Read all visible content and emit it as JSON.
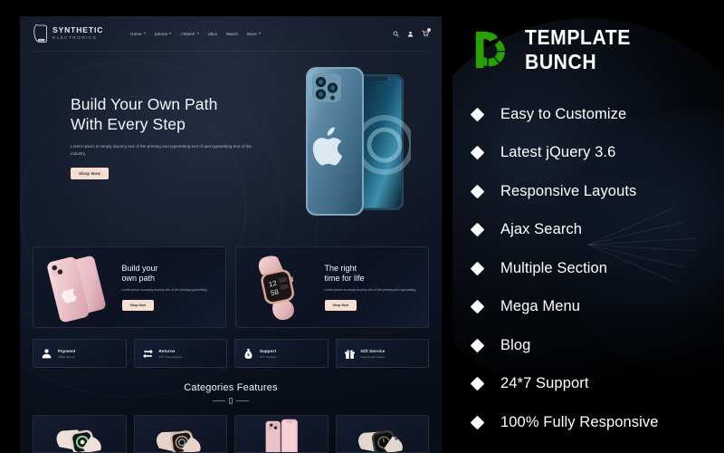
{
  "promo_panel": {
    "brand_name": "TEMPLATE BUNCH",
    "logo_icon": "template-bunch-b-logo",
    "accent_color": "#26a300",
    "features": [
      "Easy to Customize",
      "Latest jQuery 3.6",
      "Responsive Layouts",
      "Ajax Search",
      "Multiple Section",
      "Mega Menu",
      "Blog",
      "24*7 Support",
      "100% Fully Responsive"
    ]
  },
  "site_preview": {
    "header": {
      "logo_icon": "phone-outline-icon",
      "brand_line1": "SYNTHETIC",
      "brand_line2": "ELECTRONICS",
      "nav": [
        {
          "label": "Home",
          "has_dropdown": true
        },
        {
          "label": "Iphone",
          "has_dropdown": true
        },
        {
          "label": "I Watch",
          "has_dropdown": true
        },
        {
          "label": "Ultra",
          "has_dropdown": false
        },
        {
          "label": "Watch",
          "has_dropdown": false
        },
        {
          "label": "More",
          "has_dropdown": true
        }
      ],
      "icons": [
        "search-icon",
        "user-icon",
        "cart-icon"
      ]
    },
    "hero": {
      "title_line1": "Build Your Own Path",
      "title_line2": "With Every Step",
      "paragraph": "Lorem Ipsum is simply dummy text of the printing and typesetting text of and typesetting text of the industry.",
      "button": "Shop Now",
      "product_image": "blue-iphone-12-pro"
    },
    "promos": [
      {
        "title_line1": "Build your",
        "title_line2": "own path",
        "paragraph": "Lorem Ipsum is simply dummy text of the printing typesetting.",
        "button": "Shop Now",
        "image": "pink-iphone-13"
      },
      {
        "title_line1": "The right",
        "title_line2": "time for life",
        "paragraph": "Lorem Ipsum is simply dummy text of the printing and typesetting.",
        "button": "Shop Now",
        "image": "pink-smartwatch"
      }
    ],
    "services": [
      {
        "icon": "payment-icon",
        "title": "Payment",
        "subtitle": "100% Secure"
      },
      {
        "icon": "returns-icon",
        "title": "Returns",
        "subtitle": "24*7 Free Returns"
      },
      {
        "icon": "support-icon",
        "title": "Support",
        "subtitle": "24*7 Support"
      },
      {
        "icon": "gift-icon",
        "title": "Gift Service",
        "subtitle": "Support gift service"
      }
    ],
    "categories": {
      "title": "Categories Features",
      "products": [
        "white-smartwatch",
        "rose-smartwatch",
        "pink-iphone-13",
        "dark-smartwatch"
      ]
    }
  }
}
